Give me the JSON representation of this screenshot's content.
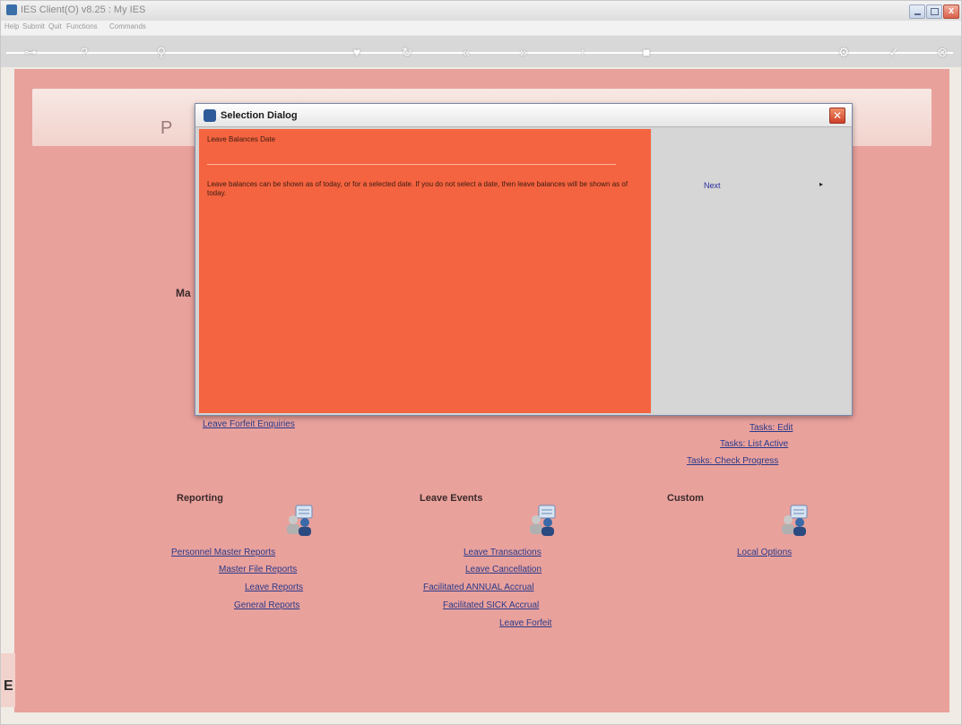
{
  "window": {
    "title": "IES Client(O) v8.25 : My IES",
    "min_glyph": "_",
    "max_glyph": "□",
    "close_glyph": "x"
  },
  "menu": [
    "Help",
    "Submit",
    "Quit",
    "Functions",
    "Commands"
  ],
  "toolbar": {
    "buttons": [
      {
        "icon": "key-icon",
        "glyph": "⊶"
      },
      {
        "icon": "help-icon",
        "glyph": "?"
      },
      {
        "icon": "search-icon",
        "glyph": "⚲"
      },
      {
        "icon": "heart-icon",
        "glyph": "♥"
      },
      {
        "icon": "refresh-icon",
        "glyph": "↻"
      },
      {
        "icon": "back-icon",
        "glyph": "«"
      },
      {
        "icon": "forward-icon",
        "glyph": "»"
      },
      {
        "icon": "up-icon",
        "glyph": "↑"
      },
      {
        "icon": "stop-icon",
        "glyph": "■"
      },
      {
        "icon": "settings-icon",
        "glyph": "⚙"
      },
      {
        "icon": "check-icon",
        "glyph": "✓"
      },
      {
        "icon": "exit-icon",
        "glyph": "⊗"
      }
    ]
  },
  "page": {
    "header_letter": "P",
    "partial_heading": "Ma",
    "side_letter": "E",
    "upper_links": {
      "left": [
        "Leave Forfeit Enquiries"
      ],
      "right": [
        "Tasks: Edit",
        "Tasks: List Active",
        "Tasks: Check Progress"
      ]
    },
    "sections": [
      {
        "title": "Reporting",
        "links": [
          "Personnel Master Reports",
          "Master File Reports",
          "Leave Reports",
          "General Reports"
        ]
      },
      {
        "title": "Leave Events",
        "links": [
          "Leave Transactions",
          "Leave Cancellation",
          "Facilitated ANNUAL Accrual",
          "Facilitated SICK Accrual",
          "Leave Forfeit"
        ]
      },
      {
        "title": "Custom",
        "links": [
          "Local Options"
        ]
      }
    ]
  },
  "dialog": {
    "title": "Selection Dialog",
    "heading": "Leave Balances Date",
    "description": "Leave balances can be shown as of today, or for a selected date. If you do not select a date, then leave balances will be shown as of today.",
    "next_label": "Next",
    "next_arrow": "▸",
    "close_glyph": "✕"
  },
  "colors": {
    "main_bg": "#e9a19c",
    "dialog_left": "#f56440",
    "dialog_right": "#d6d6d6",
    "link": "#2a3a8a"
  }
}
